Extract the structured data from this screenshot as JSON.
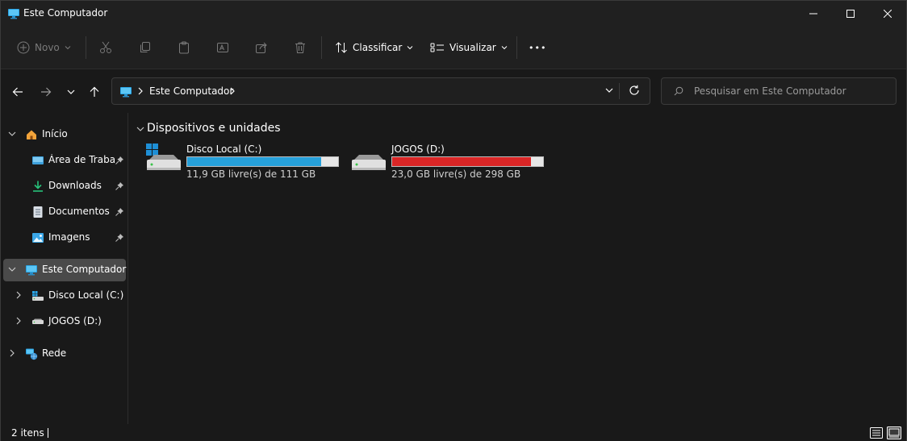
{
  "window": {
    "title": "Este Computador"
  },
  "toolbar": {
    "new_label": "Novo",
    "sort_label": "Classificar",
    "view_label": "Visualizar",
    "more_label": "•••"
  },
  "address": {
    "path": "Este Computador",
    "search_placeholder": "Pesquisar em Este Computador"
  },
  "sidebar": {
    "items": [
      {
        "label": "Início",
        "icon": "home-icon"
      },
      {
        "label": "Área de Trabalho",
        "icon": "desktop-icon",
        "pinned": true
      },
      {
        "label": "Downloads",
        "icon": "download-icon",
        "pinned": true
      },
      {
        "label": "Documentos",
        "icon": "document-icon",
        "pinned": true
      },
      {
        "label": "Imagens",
        "icon": "pictures-icon",
        "pinned": true
      },
      {
        "label": "Este Computador",
        "icon": "computer-icon",
        "selected": true
      },
      {
        "label": "Disco Local (C:)",
        "icon": "drive-c-icon"
      },
      {
        "label": "JOGOS (D:)",
        "icon": "drive-icon"
      },
      {
        "label": "Rede",
        "icon": "network-icon"
      }
    ]
  },
  "main": {
    "group_title": "Dispositivos e unidades",
    "drives": [
      {
        "name": "Disco Local (C:)",
        "free_text": "11,9 GB livre(s) de 111 GB",
        "used_fraction": 0.89,
        "bar_color": "#26a0da"
      },
      {
        "name": "JOGOS (D:)",
        "free_text": "23,0 GB livre(s) de 298 GB",
        "used_fraction": 0.92,
        "bar_color": "#da2626"
      }
    ]
  },
  "status": {
    "item_count": "2 itens"
  },
  "colors": {
    "background": "#191919",
    "chrome": "#202020",
    "selected": "#4a4a4a",
    "accent": "#26a0da",
    "danger": "#da2626"
  }
}
